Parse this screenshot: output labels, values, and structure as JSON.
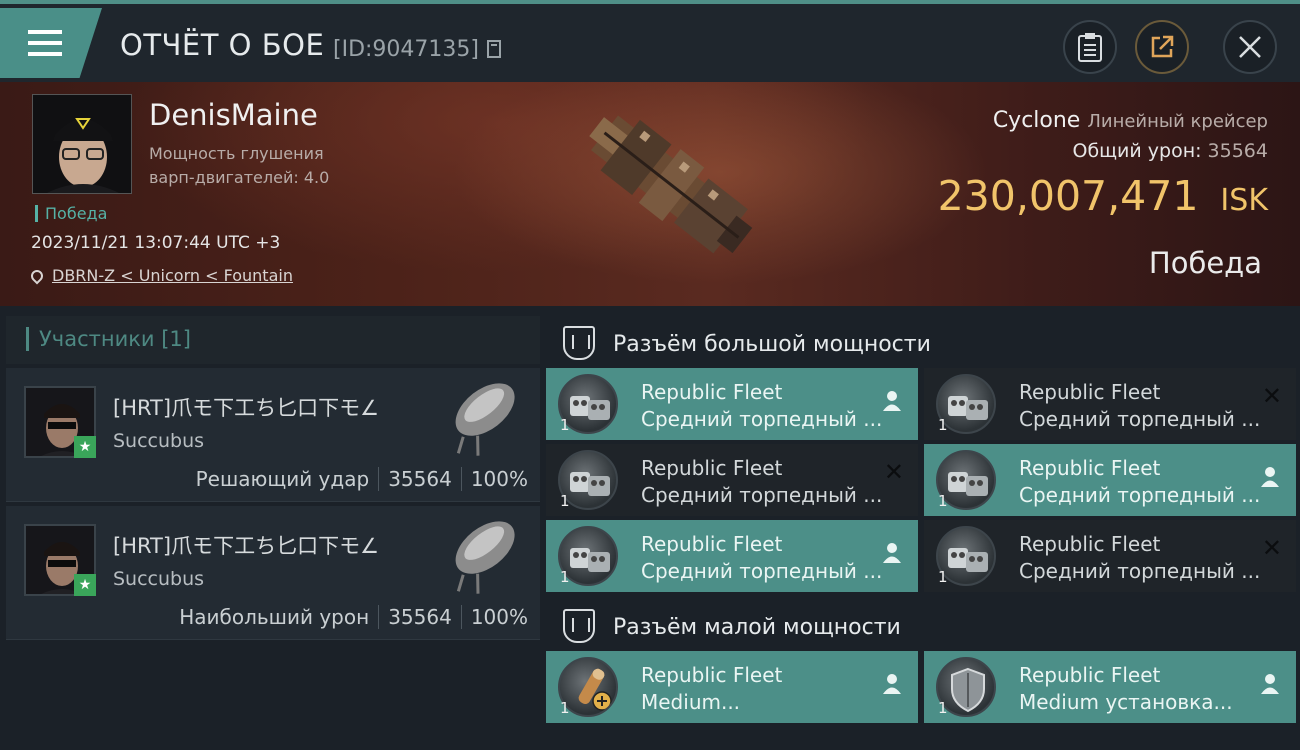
{
  "header": {
    "title": "ОТЧЁТ О БОЕ",
    "report_id": "[ID:9047135]"
  },
  "pilot": {
    "name": "DenisMaine",
    "warp_line1": "Мощность глушения",
    "warp_line2": "варп-двигателей: 4.0",
    "status": "Победа",
    "datetime": "2023/11/21 13:07:44 UTC +3",
    "location": "DBRN-Z < Unicorn < Fountain"
  },
  "victim_ship": {
    "name": "Cyclone",
    "class": "Линейный крейсер",
    "total_damage_label": "Общий урон:",
    "total_damage": "35564",
    "isk_value": "230,007,471",
    "isk_unit": "ISK",
    "result": "Победа"
  },
  "participants": {
    "header": "Участники [1]",
    "rows": [
      {
        "name": "[HRT]爪モ下工ち匕口下モ∠",
        "ship": "Succubus",
        "role": "Решающий удар",
        "damage": "35564",
        "percent": "100%"
      },
      {
        "name": "[HRT]爪モ下工ち匕口下モ∠",
        "ship": "Succubus",
        "role": "Наибольший урон",
        "damage": "35564",
        "percent": "100%"
      }
    ]
  },
  "high_slots": {
    "header": "Разъём большой мощности",
    "items": [
      {
        "line1": "Republic Fleet",
        "line2": "Средний торпедный ...",
        "qty": "1",
        "state": "dropped"
      },
      {
        "line1": "Republic Fleet",
        "line2": "Средний торпедный ...",
        "qty": "1",
        "state": "destroyed"
      },
      {
        "line1": "Republic Fleet",
        "line2": "Средний торпедный ...",
        "qty": "1",
        "state": "destroyed"
      },
      {
        "line1": "Republic Fleet",
        "line2": "Средний торпедный ...",
        "qty": "1",
        "state": "dropped"
      },
      {
        "line1": "Republic Fleet",
        "line2": "Средний торпедный ...",
        "qty": "1",
        "state": "dropped"
      },
      {
        "line1": "Republic Fleet",
        "line2": "Средний торпедный ...",
        "qty": "1",
        "state": "destroyed"
      }
    ]
  },
  "mid_slots": {
    "header": "Разъём малой мощности",
    "items": [
      {
        "line1": "Republic Fleet",
        "line2": "Medium...",
        "qty": "1",
        "state": "dropped"
      },
      {
        "line1": "Republic Fleet",
        "line2": "Medium установка...",
        "qty": "1",
        "state": "dropped"
      }
    ]
  },
  "colors": {
    "accent": "#4c8f88",
    "isk": "#f1c46a",
    "hero": "#4c2219"
  }
}
